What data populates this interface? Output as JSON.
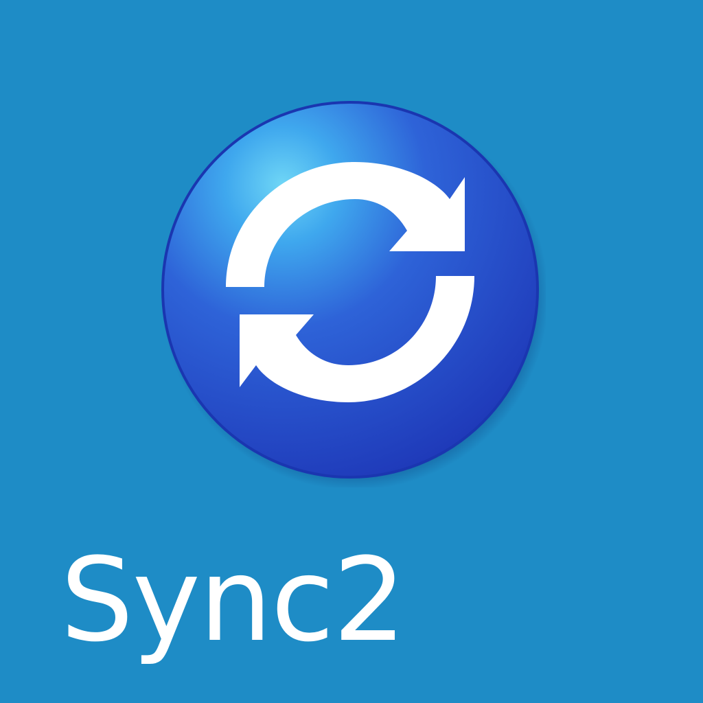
{
  "desktop_icon": {
    "label": "Sync2",
    "icon": "sync-arrows-icon"
  },
  "colors": {
    "background": "#1E8CC6",
    "orb_light": "#5FC8F2",
    "orb_mid": "#2E63D8",
    "orb_dark": "#1E38B8",
    "arrow": "#FFFFFF",
    "label_text": "#FFFFFF"
  }
}
